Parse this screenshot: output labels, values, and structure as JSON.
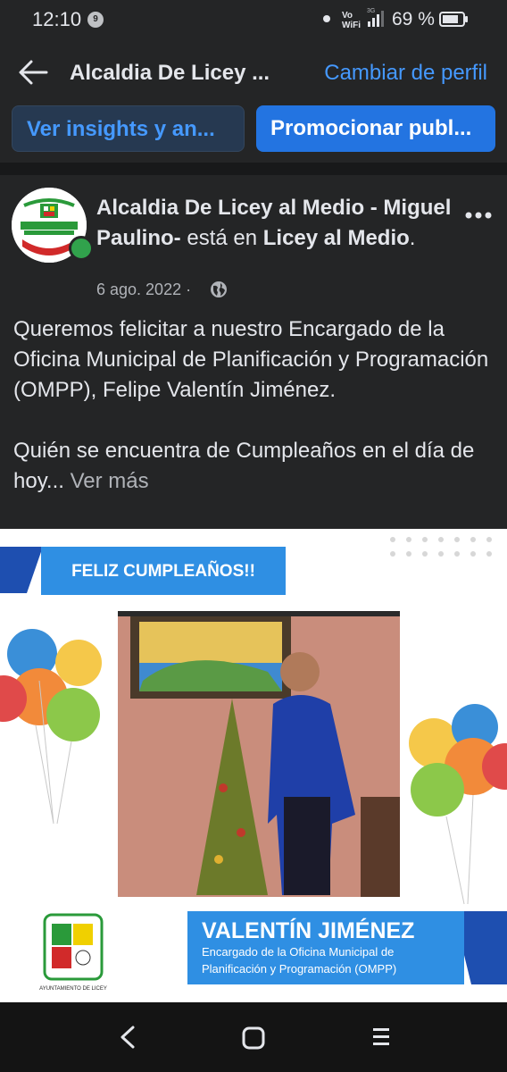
{
  "status_bar": {
    "time": "12:10",
    "notification_badge": "9",
    "network_label": "Vo\nWiFi",
    "network_gen": "3G",
    "battery_percent": "69 %"
  },
  "header": {
    "title": "Alcaldia De Licey ...",
    "switch_profile": "Cambiar de perfil"
  },
  "actions": {
    "insights_label": "Ver insights y an...",
    "promote_label": "Promocionar publ..."
  },
  "post": {
    "author_name": "Alcaldia De Licey al Medio - Miguel Paulino-",
    "author_connector": " está en ",
    "location": "Licey al Medio",
    "location_suffix": ".",
    "date": "6 ago. 2022 ·",
    "paragraph_1": "Queremos felicitar a nuestro Encargado de la Oficina Municipal de Planificación y Programación (OMPP), Felipe Valentín Jiménez.",
    "paragraph_2": "Quién se encuentra de Cumpleaños en el día de hoy...",
    "see_more": " Ver más"
  },
  "image": {
    "banner_text": "FELIZ CUMPLEAÑOS!!",
    "name_text": "VALENTÍN JIMÉNEZ",
    "role_line_1": "Encargado de la Oficina Municipal de",
    "role_line_2": "Planificación y Programación (OMPP)",
    "seal_caption": "AYUNTAMIENTO DE LICEY"
  },
  "colors": {
    "background": "#242526",
    "accent_blue": "#4599ff",
    "promote_button": "#2374e1",
    "online_green": "#31a24c",
    "banner_blue": "#2f8fe3"
  }
}
